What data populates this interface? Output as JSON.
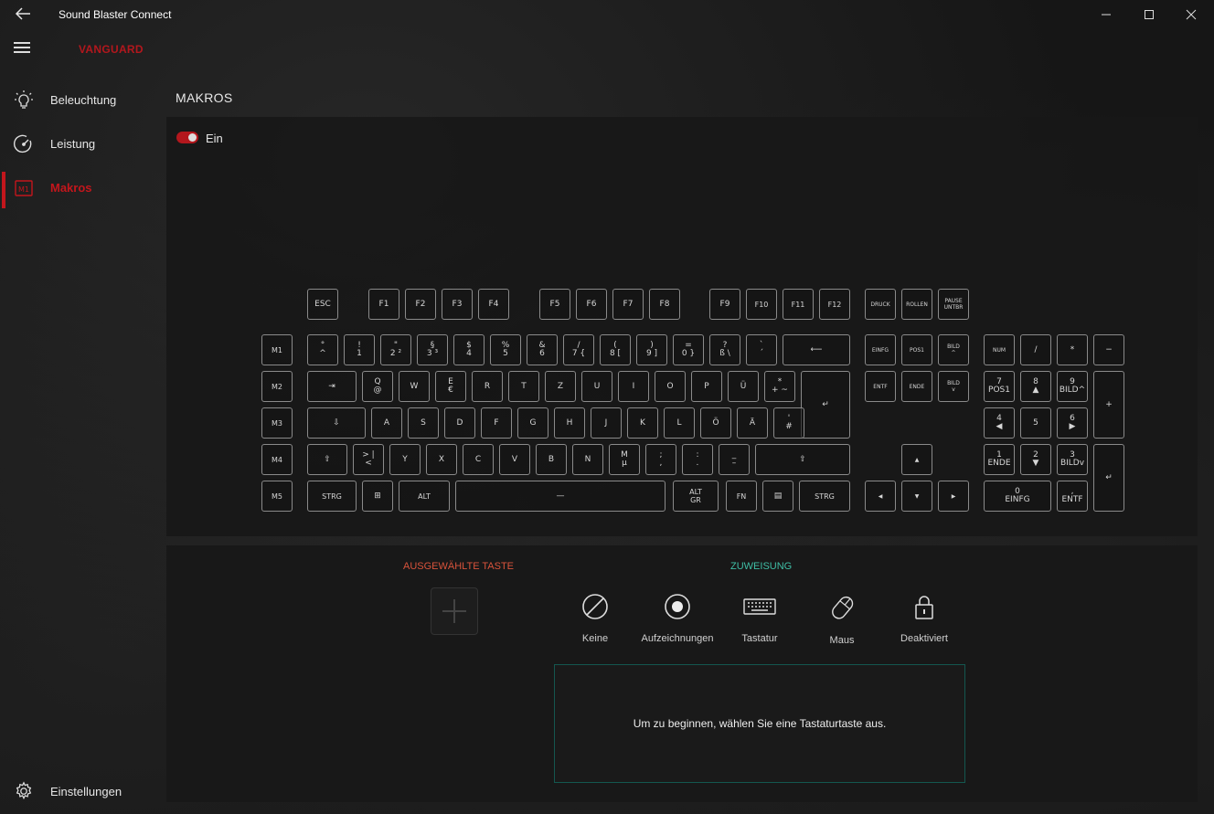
{
  "window": {
    "title": "Sound Blaster Connect",
    "back_icon": "back-arrow-icon",
    "minimize_icon": "minimize-icon",
    "maximize_icon": "maximize-icon",
    "close_icon": "close-icon"
  },
  "header": {
    "device": "VANGUARD",
    "menu_icon": "hamburger-menu-icon"
  },
  "sidebar": {
    "items": [
      {
        "label": "Beleuchtung",
        "icon": "lightbulb-icon"
      },
      {
        "label": "Leistung",
        "icon": "speedometer-icon"
      },
      {
        "label": "Makros",
        "icon": "macro-icon",
        "active": true
      }
    ],
    "settings": {
      "label": "Einstellungen",
      "icon": "gear-icon"
    }
  },
  "page": {
    "title": "MAKROS"
  },
  "toggle": {
    "state": "on",
    "label": "Ein"
  },
  "keyboard": {
    "f_row": [
      "ESC",
      "F1",
      "F2",
      "F3",
      "F4",
      "F5",
      "F6",
      "F7",
      "F8",
      "F9",
      "F10",
      "F11",
      "F12",
      "DRUCK",
      "ROLLEN",
      "PAUSE\nUNTBR"
    ],
    "macro_keys": [
      "M1",
      "M2",
      "M3",
      "M4",
      "M5"
    ],
    "row1": [
      "°\n^",
      "!\n1",
      "\"\n2 ²",
      "§\n3 ³",
      "$\n4",
      "%\n5",
      "&\n6",
      "/\n7 {",
      "(\n8 [",
      ")\n9 ]",
      "=\n0 }",
      "?\nß \\",
      "`\n´",
      "⟵"
    ],
    "row2": [
      "⇥",
      "Q\n@",
      "W",
      "E\n€",
      "R",
      "T",
      "Z",
      "U",
      "I",
      "O",
      "P",
      "Ü",
      "*\n+ ~",
      "↵"
    ],
    "row3": [
      "⇩",
      "A",
      "S",
      "D",
      "F",
      "G",
      "H",
      "J",
      "K",
      "L",
      "Ö",
      "Ä",
      "'\n#"
    ],
    "row4": [
      "⇧",
      "> |\n<",
      "Y",
      "X",
      "C",
      "V",
      "B",
      "N",
      "M\nµ",
      ";\n,",
      ":\n.",
      "_\n–",
      "⇧"
    ],
    "row5": [
      "STRG",
      "⊞",
      "ALT",
      "—",
      "ALT\nGR",
      "FN",
      "▤",
      "STRG"
    ],
    "nav_cluster": [
      "EINFG",
      "POS1",
      "BILD\n^",
      "ENTF",
      "ENDE",
      "BILD\nv",
      "▲",
      "◀",
      "▼",
      "▶"
    ],
    "numpad": [
      "NUM",
      "/",
      "*",
      "−",
      "7\nPOS1",
      "8\n▲",
      "9\nBILD^",
      "+",
      "4\n◀",
      "5",
      "6\n▶",
      "1\nENDE",
      "2\n▼",
      "3\nBILDv",
      "↵",
      "0\nEINFG",
      ",\nENTF"
    ]
  },
  "bottom": {
    "selected_heading": "AUSGEWÄHLTE TASTE",
    "assignment_heading": "ZUWEISUNG",
    "options": [
      {
        "label": "Keine",
        "icon": "none-icon"
      },
      {
        "label": "Aufzeichnungen",
        "icon": "record-icon"
      },
      {
        "label": "Tastatur",
        "icon": "keyboard-icon"
      },
      {
        "label": "Maus",
        "icon": "mouse-icon"
      },
      {
        "label": "Deaktiviert",
        "icon": "lock-icon"
      }
    ],
    "message": "Um zu beginnen, wählen Sie eine Tastaturtaste aus."
  },
  "colors": {
    "accent_red": "#c3161c",
    "accent_teal": "#3fbfa6",
    "heading_orange": "#d9533b"
  }
}
